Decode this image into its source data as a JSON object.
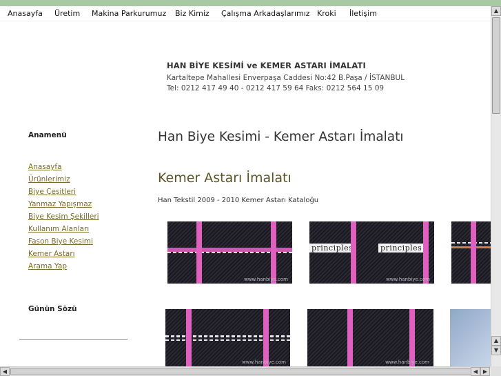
{
  "nav": {
    "items": [
      "Anasayfa",
      "Üretim",
      "Makina Parkurumuz",
      "Biz Kimiz",
      "Çalışma Arkadaşlarımız",
      "Kroki",
      "İletişim"
    ]
  },
  "header": {
    "title": "HAN BİYE KESİMİ ve KEMER ASTARI İMALATI",
    "address": "Kartaltepe Mahallesi Enverpaşa Caddesi No:42 B.Paşa / İSTANBUL",
    "phone": "Tel: 0212 417 49 40 - 0212 417 59 64 Faks: 0212 564 15 09"
  },
  "sidebar": {
    "menu_heading": "Anamenü",
    "links": [
      "Anasayfa",
      "Ürünlerimiz",
      "Biye Çeşitleri",
      "Yanmaz Yapışmaz",
      "Biye Kesim Şekilleri",
      "Kullanım Alanları",
      "Fason Biye Kesimi",
      "Kemer Astarı",
      "Arama Yap"
    ],
    "quote_heading": "Günün Sözü"
  },
  "main": {
    "title": "Han Biye Kesimi - Kemer Astarı İmalatı",
    "subtitle": "Kemer Astarı İmalatı",
    "caption": "Han Tekstil 2009 - 2010 Kemer Astarı Kataloğu"
  },
  "thumbnails": {
    "watermark": "www.hanbiye.com",
    "fabric_text": "principles"
  },
  "colors": {
    "top_strip": "#a9c8a4",
    "link": "#7a6a2a",
    "subtitle": "#5c5424",
    "stripe_pink": "#e060c0"
  }
}
